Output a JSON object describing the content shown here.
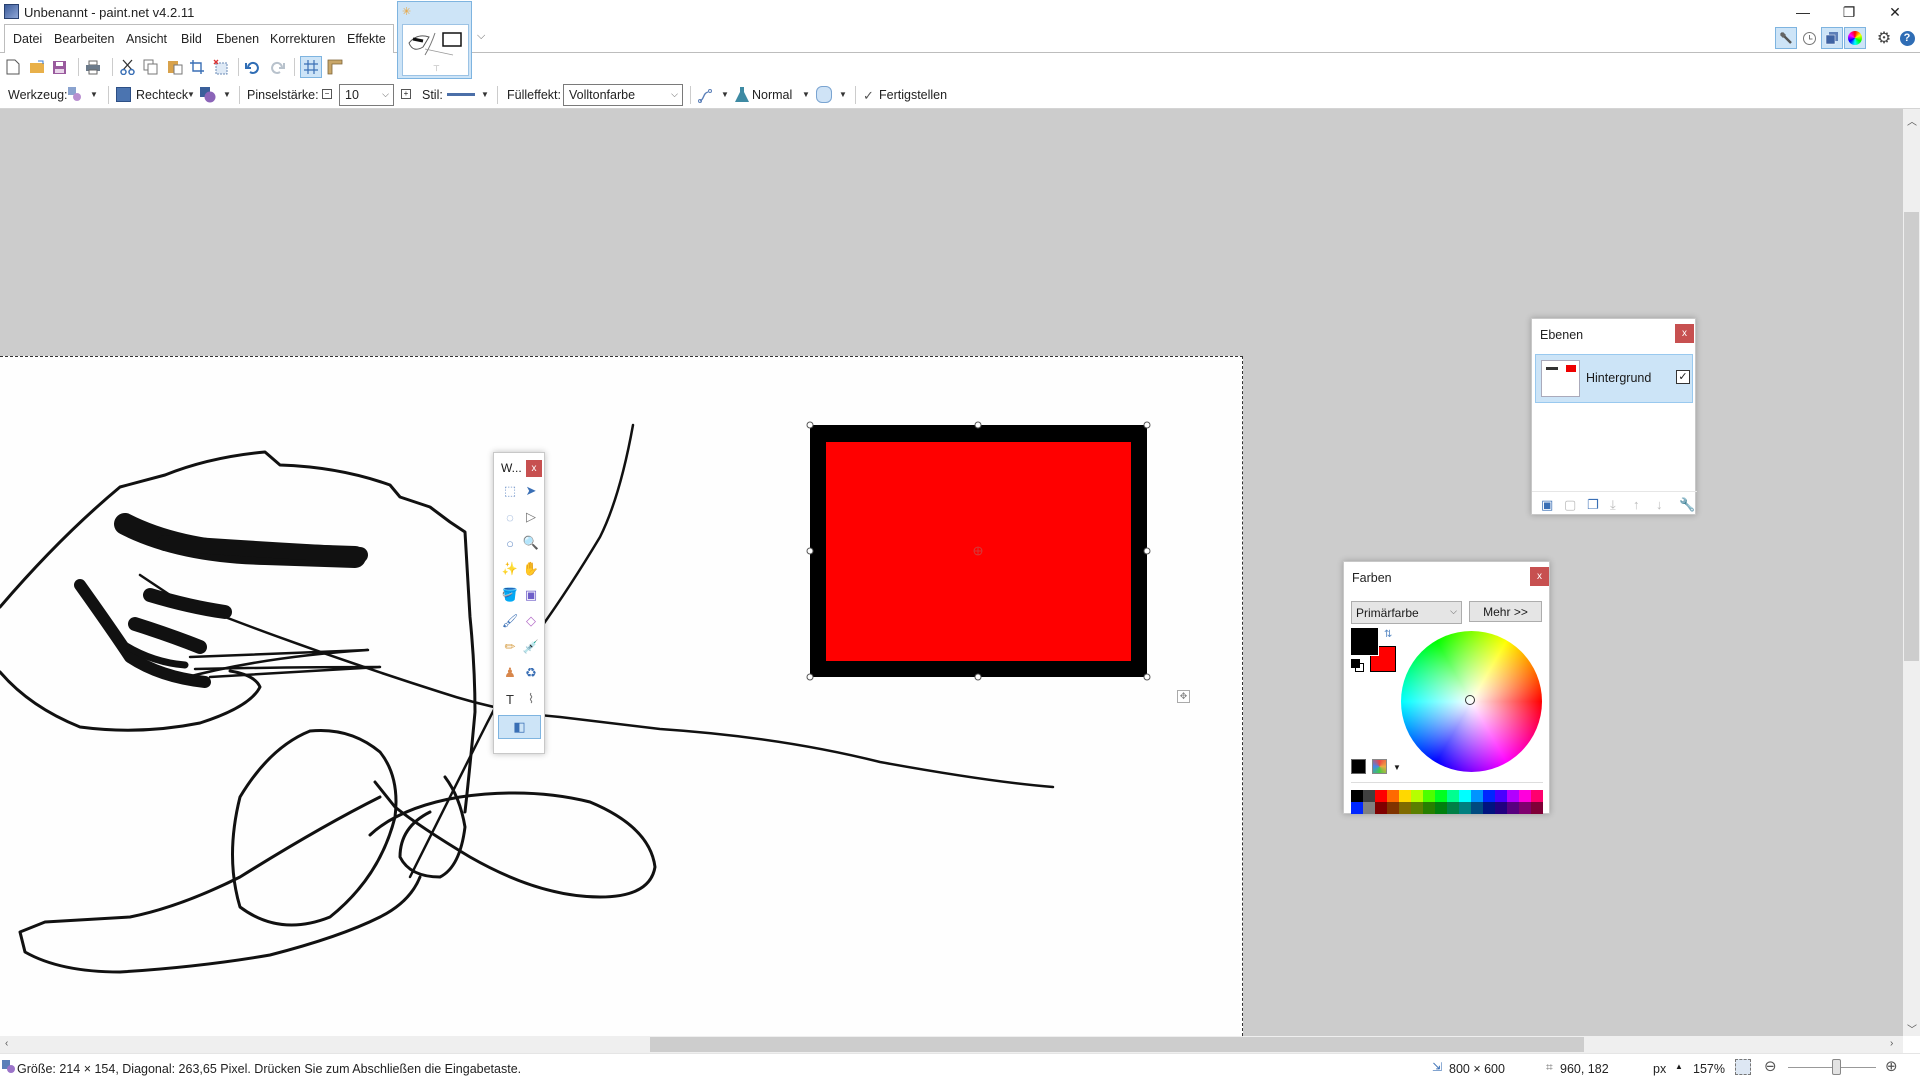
{
  "window": {
    "title": "Unbenannt - paint.net v4.2.11",
    "controls": {
      "minimize": "—",
      "restore": "❐",
      "close": "✕"
    }
  },
  "menu": {
    "items": [
      "Datei",
      "Bearbeiten",
      "Ansicht",
      "Bild",
      "Ebenen",
      "Korrekturen",
      "Effekte"
    ]
  },
  "doc_tab": {
    "modified_marker": "✳"
  },
  "toolbar": {
    "icons": [
      "new-icon",
      "open-icon",
      "save-icon",
      "print-icon",
      "cut-icon",
      "copy-icon",
      "paste-icon",
      "crop-icon",
      "deselect-icon",
      "undo-icon",
      "redo-icon",
      "grid-icon",
      "ruler-icon"
    ]
  },
  "right_tools": {
    "icons": [
      "tools-window-icon",
      "history-window-icon",
      "layers-window-icon",
      "colors-window-icon",
      "settings-icon",
      "help-icon"
    ]
  },
  "tool_options": {
    "tool_label": "Werkzeug:",
    "shape_label": "Rechteck",
    "brush_width_label": "Pinselstärke:",
    "brush_width_value": "10",
    "style_label": "Stil:",
    "fill_label": "Fülleffekt:",
    "fill_value": "Volltonfarbe",
    "blend_mode": "Normal",
    "finish_label": "Fertigstellen"
  },
  "tools_panel": {
    "title": "W...",
    "close": "x",
    "tools": [
      {
        "name": "rectangle-select",
        "glyph": "⬚"
      },
      {
        "name": "move-selected-pixels",
        "glyph": "➤"
      },
      {
        "name": "lasso-select",
        "glyph": "◌"
      },
      {
        "name": "move-selection",
        "glyph": "▷"
      },
      {
        "name": "ellipse-select",
        "glyph": "○"
      },
      {
        "name": "zoom",
        "glyph": "🔍"
      },
      {
        "name": "magic-wand",
        "glyph": "✨"
      },
      {
        "name": "pan",
        "glyph": "✋"
      },
      {
        "name": "paint-bucket",
        "glyph": "🪣"
      },
      {
        "name": "gradient",
        "glyph": "▣"
      },
      {
        "name": "paintbrush",
        "glyph": "🖌"
      },
      {
        "name": "eraser",
        "glyph": "◇"
      },
      {
        "name": "pencil",
        "glyph": "✏"
      },
      {
        "name": "color-picker",
        "glyph": "💉"
      },
      {
        "name": "clone-stamp",
        "glyph": "♟"
      },
      {
        "name": "recolor",
        "glyph": "♻"
      },
      {
        "name": "text",
        "glyph": "T"
      },
      {
        "name": "line-curve",
        "glyph": "⌇"
      },
      {
        "name": "shapes",
        "glyph": "◧"
      }
    ]
  },
  "layers_panel": {
    "title": "Ebenen",
    "close": "x",
    "layers": [
      {
        "name": "Hintergrund",
        "visible": true,
        "checkmark": "✓"
      }
    ],
    "footer_icons": [
      "add-layer-icon",
      "delete-layer-icon",
      "duplicate-layer-icon",
      "merge-layer-down-icon",
      "move-layer-up-icon",
      "move-layer-down-icon",
      "layer-properties-icon"
    ]
  },
  "colors_panel": {
    "title": "Farben",
    "close": "x",
    "selector_value": "Primärfarbe",
    "more_button": "Mehr >>",
    "primary_color": "#000000",
    "secondary_color": "#ff0000",
    "palette_row1": [
      "#000000",
      "#404040",
      "#ff0000",
      "#ff6a00",
      "#ffd800",
      "#b6ff00",
      "#4cff00",
      "#00ff21",
      "#00ff90",
      "#00ffff",
      "#0094ff",
      "#0026ff",
      "#4800ff",
      "#b200ff",
      "#ff00dc",
      "#ff006e"
    ],
    "palette_row2": [
      "#0026ff",
      "#808080",
      "#7f0000",
      "#7f3300",
      "#7f6a00",
      "#5b7f00",
      "#267f00",
      "#007f0e",
      "#007f46",
      "#007f7f",
      "#004a7f",
      "#00137f",
      "#21007f",
      "#57007f",
      "#7f006e",
      "#7f0037"
    ]
  },
  "canvas": {
    "shape": {
      "type": "Rechteck",
      "fill": "#ff0000",
      "outline": "#000000"
    }
  },
  "statusbar": {
    "message": "Größe: 214 × 154, Diagonal: 263,65 Pixel. Drücken Sie zum Abschließen die Eingabetaste.",
    "image_size": "800 × 600",
    "cursor_position": "960, 182",
    "units": "px",
    "zoom": "157%",
    "zoom_slider_fraction": 0.55
  }
}
